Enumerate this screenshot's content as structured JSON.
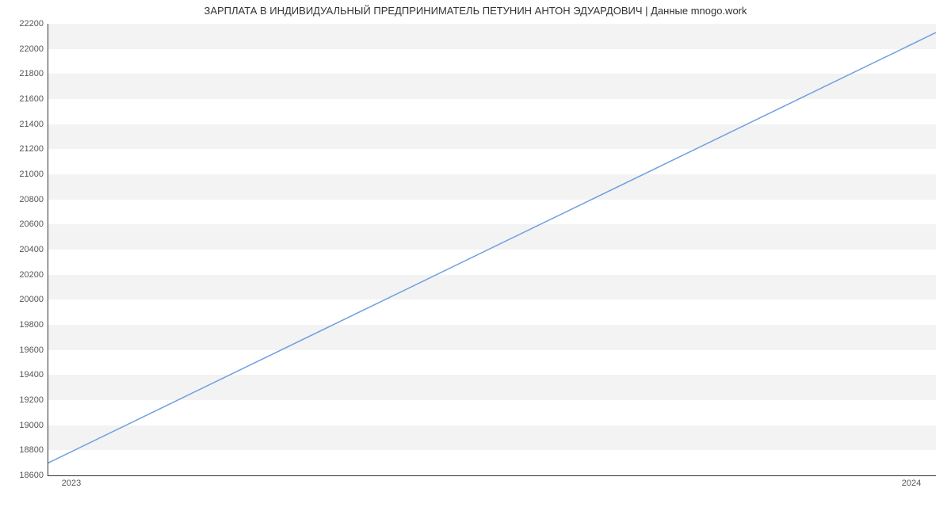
{
  "chart_data": {
    "type": "line",
    "title": "ЗАРПЛАТА В ИНДИВИДУАЛЬНЫЙ ПРЕДПРИНИМАТЕЛЬ ПЕТУНИН АНТОН ЭДУАРДОВИЧ | Данные mnogo.work",
    "xlabel": "",
    "ylabel": "",
    "x_categories": [
      "2023",
      "2024"
    ],
    "x_numeric": [
      2023,
      2024
    ],
    "values": [
      18700,
      22130
    ],
    "ylim": [
      18600,
      22200
    ],
    "y_ticks": [
      18600,
      18800,
      19000,
      19200,
      19400,
      19600,
      19800,
      20000,
      20200,
      20400,
      20600,
      20800,
      21000,
      21200,
      21400,
      21600,
      21800,
      22000,
      22200
    ],
    "grid_bands": true
  }
}
